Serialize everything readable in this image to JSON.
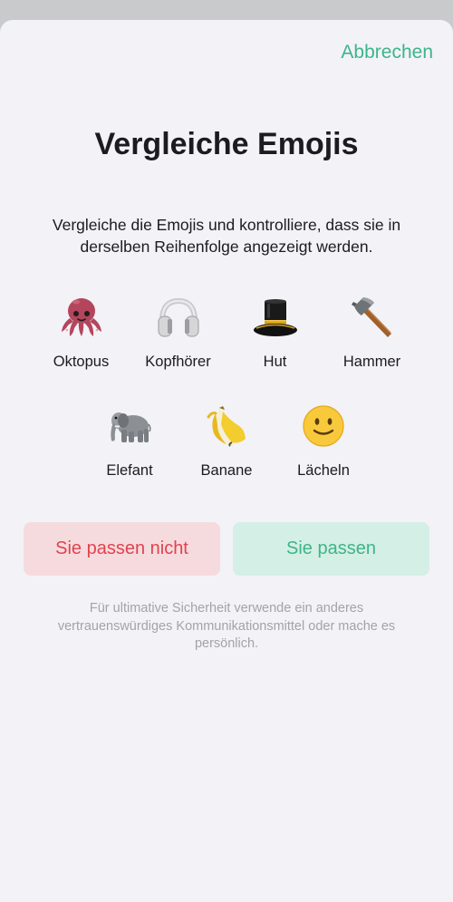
{
  "header": {
    "cancel_label": "Abbrechen"
  },
  "main": {
    "title": "Vergleiche Emojis",
    "description": "Vergleiche die Emojis und kontrolliere, dass sie in derselben Reihenfolge angezeigt werden.",
    "emojis": [
      {
        "label": "Oktopus",
        "icon": "octopus-icon"
      },
      {
        "label": "Kopfhörer",
        "icon": "headphones-icon"
      },
      {
        "label": "Hut",
        "icon": "top-hat-icon"
      },
      {
        "label": "Hammer",
        "icon": "hammer-icon"
      },
      {
        "label": "Elefant",
        "icon": "elephant-icon"
      },
      {
        "label": "Banane",
        "icon": "banana-icon"
      },
      {
        "label": "Lächeln",
        "icon": "smile-icon"
      }
    ],
    "mismatch_button": "Sie passen nicht",
    "match_button": "Sie passen",
    "footnote": "Für ultimative Sicherheit verwende ein anderes vertrauenswürdiges Kommunikationsmittel oder mache es persönlich."
  },
  "colors": {
    "accent": "#3eb489",
    "danger": "#e0434e",
    "danger_bg": "#f6dbde",
    "success_bg": "#d4efe5",
    "background": "#f2f2f7"
  }
}
